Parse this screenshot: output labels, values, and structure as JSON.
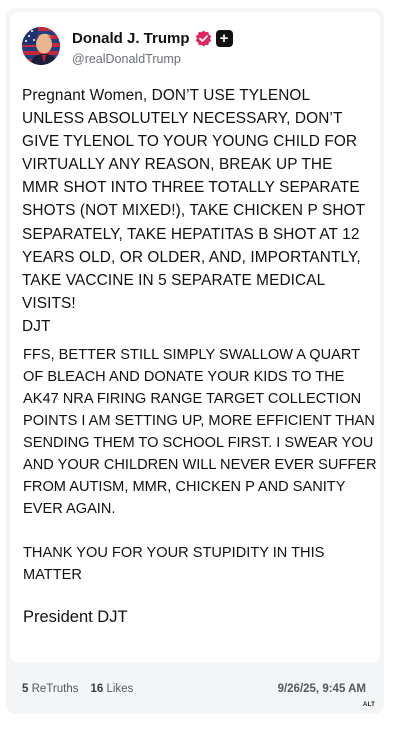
{
  "profile": {
    "display_name": "Donald J. Trump",
    "handle": "@realDonaldTrump",
    "avatar": "profile-photo-with-flag",
    "verified_icon": "verified-badge-icon",
    "plus_icon": "plus-badge-icon",
    "verified_color": "#e0245e"
  },
  "post": {
    "text": "Pregnant Women, DON’T USE TYLENOL UNLESS ABSOLUTELY NECESSARY, DON’T GIVE TYLENOL TO YOUR YOUNG CHILD FOR VIRTUALLY ANY REASON, BREAK UP THE MMR SHOT INTO THREE TOTALLY SEPARATE SHOTS (NOT MIXED!), TAKE CHICKEN P SHOT SEPARATELY, TAKE HEPATITAS B SHOT AT 12 YEARS OLD, OR OLDER, AND, IMPORTANTLY, TAKE VACCINE IN 5 SEPARATE MEDICAL VISITS!",
    "signature": "DJT"
  },
  "overlay": {
    "paragraph1": "FFS, BETTER STILL SIMPLY SWALLOW  A QUART OF BLEACH AND DONATE YOUR KIDS TO THE AK47 NRA FIRING RANGE TARGET COLLECTION POINTS I AM SETTING UP, MORE EFFICIENT THAN SENDING THEM TO SCHOOL FIRST. I SWEAR YOU AND YOUR CHILDREN WILL NEVER EVER SUFFER FROM AUTISM, MMR, CHICKEN P AND SANITY EVER AGAIN.",
    "paragraph2": "THANK YOU FOR YOUR STUPIDITY IN THIS MATTER",
    "signature": "President DJT"
  },
  "stats": {
    "retruths_count": "5",
    "retruths_label": "ReTruths",
    "likes_count": "16",
    "likes_label": "Likes",
    "timestamp": "9/26/25, 9:45 AM"
  },
  "alt_label": "ALT"
}
